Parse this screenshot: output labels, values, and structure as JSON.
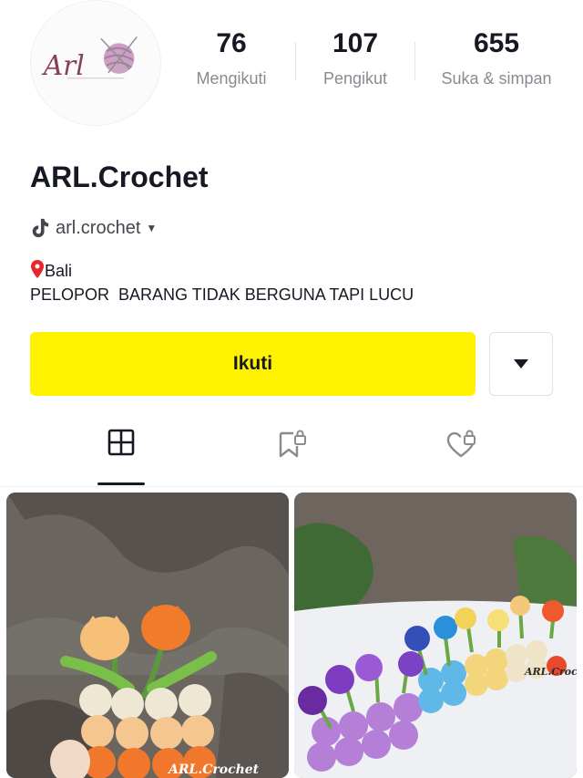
{
  "profile": {
    "avatar_brand": "Arl",
    "display_name": "ARL.Crochet",
    "handle": "arl.crochet",
    "bio_location": "Bali",
    "bio_text": "PELOPOR  BARANG TIDAK BERGUNA TAPI LUCU"
  },
  "stats": [
    {
      "value": "76",
      "label": "Mengikuti"
    },
    {
      "value": "107",
      "label": "Pengikut"
    },
    {
      "value": "655",
      "label": "Suka & simpan"
    }
  ],
  "actions": {
    "follow_label": "Ikuti"
  },
  "tabs": [
    {
      "icon": "grid-icon",
      "active": true
    },
    {
      "icon": "bookmark-lock-icon",
      "active": false
    },
    {
      "icon": "heart-lock-icon",
      "active": false
    }
  ],
  "videos": [
    {
      "watermark": "ARL.Crochet"
    },
    {
      "watermark": "ARL.Crochet"
    }
  ],
  "colors": {
    "follow_button": "#fff200",
    "text_primary": "#161823",
    "text_secondary": "#8a8b91"
  }
}
